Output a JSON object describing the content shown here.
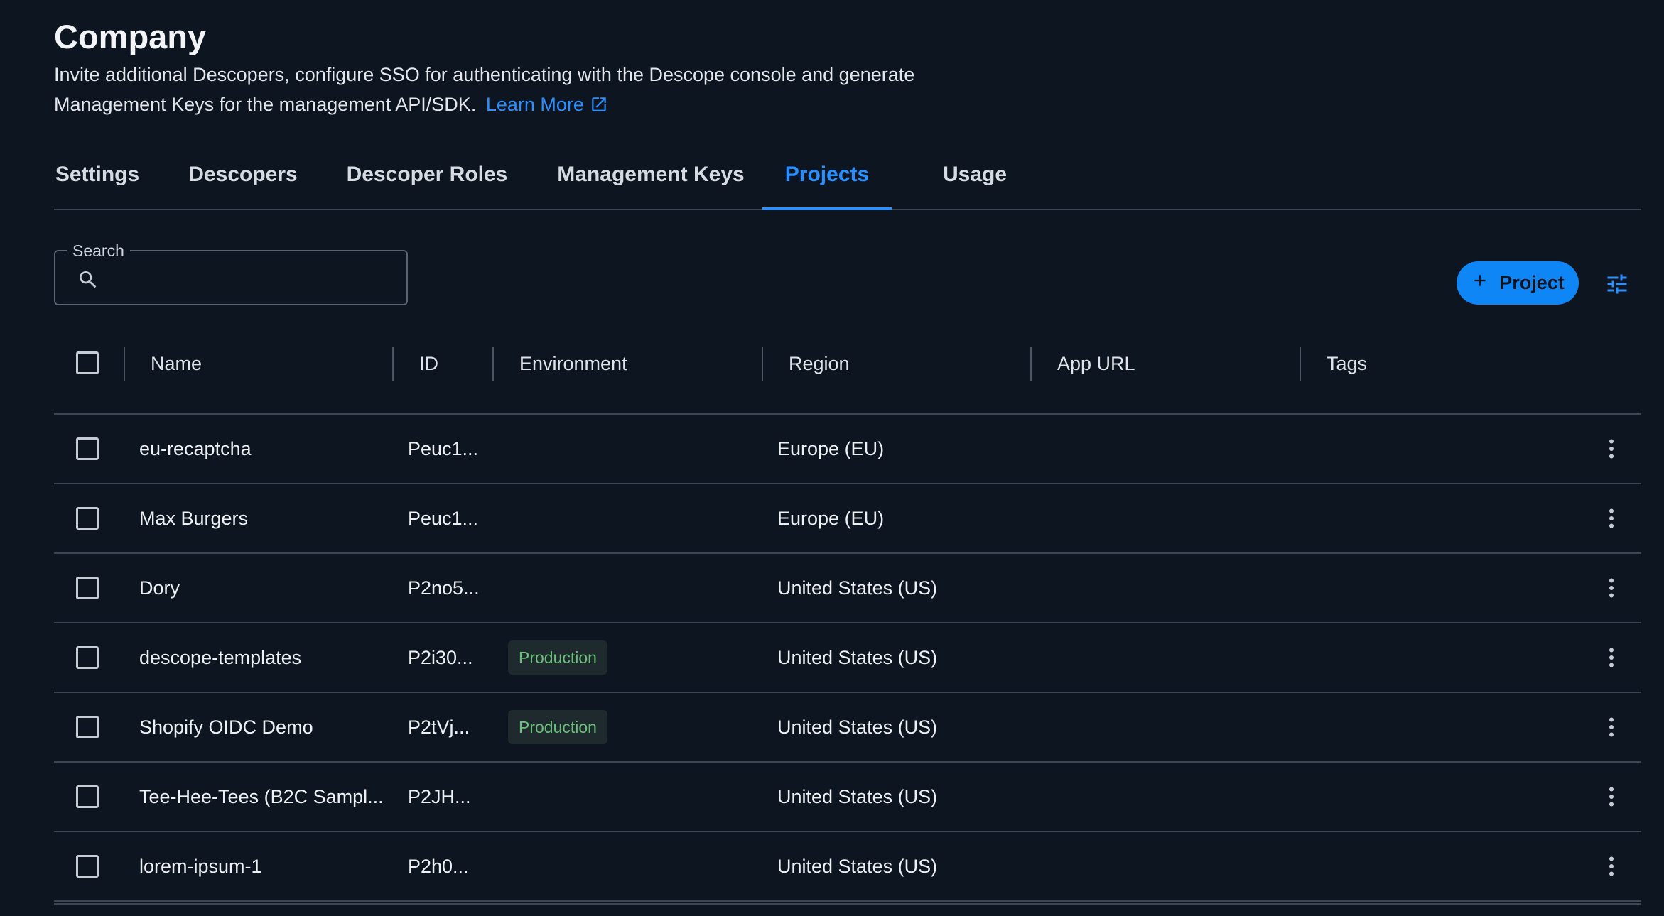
{
  "header": {
    "title": "Company",
    "description": "Invite additional Descopers, configure SSO for authenticating with the Descope console and generate Management Keys for the management API/SDK.",
    "learn_more": "Learn More"
  },
  "tabs": [
    {
      "label": "Settings",
      "active": false
    },
    {
      "label": "Descopers",
      "active": false
    },
    {
      "label": "Descoper Roles",
      "active": false
    },
    {
      "label": "Management Keys",
      "active": false
    },
    {
      "label": "Projects",
      "active": true
    },
    {
      "label": "Usage",
      "active": false
    }
  ],
  "search": {
    "label": "Search",
    "value": ""
  },
  "toolbar": {
    "add_project_label": "Project"
  },
  "table": {
    "columns": [
      "Name",
      "ID",
      "Environment",
      "Region",
      "App URL",
      "Tags"
    ],
    "rows": [
      {
        "name": "eu-recaptcha",
        "id": "Peuc1...",
        "environment": "",
        "region": "Europe (EU)",
        "app_url": "",
        "tags": ""
      },
      {
        "name": "Max Burgers",
        "id": "Peuc1...",
        "environment": "",
        "region": "Europe (EU)",
        "app_url": "",
        "tags": ""
      },
      {
        "name": "Dory",
        "id": "P2no5...",
        "environment": "",
        "region": "United States (US)",
        "app_url": "",
        "tags": ""
      },
      {
        "name": "descope-templates",
        "id": "P2i30...",
        "environment": "Production",
        "region": "United States (US)",
        "app_url": "",
        "tags": ""
      },
      {
        "name": "Shopify OIDC Demo",
        "id": "P2tVj...",
        "environment": "Production",
        "region": "United States (US)",
        "app_url": "",
        "tags": ""
      },
      {
        "name": "Tee-Hee-Tees (B2C Sampl...",
        "id": "P2JH...",
        "environment": "",
        "region": "United States (US)",
        "app_url": "",
        "tags": ""
      },
      {
        "name": "lorem-ipsum-1",
        "id": "P2h0...",
        "environment": "",
        "region": "United States (US)",
        "app_url": "",
        "tags": ""
      }
    ]
  },
  "colors": {
    "background": "#0d1521",
    "accent": "#0f86f5",
    "link": "#2a8fff",
    "badge_text": "#6cc07a",
    "badge_bg": "#1e2a2e",
    "divider": "#3b4653"
  },
  "icons": {
    "external_link": "external-link-icon",
    "search": "search-icon",
    "add": "plus-icon",
    "filter": "tune-icon",
    "row_menu": "more-vertical-icon"
  }
}
